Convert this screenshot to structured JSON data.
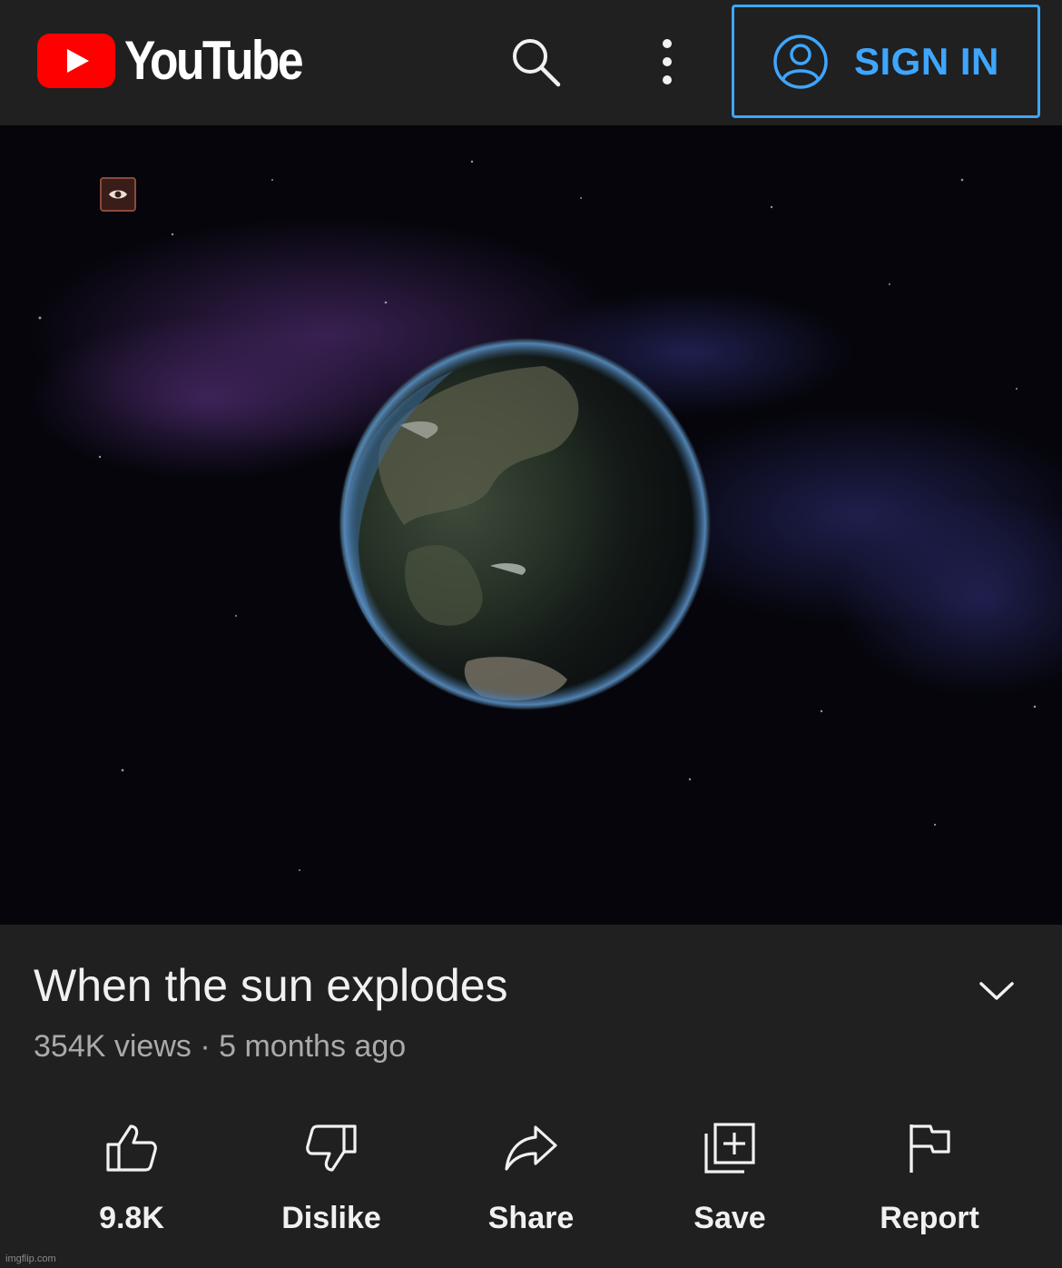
{
  "header": {
    "logo_text": "YouTube",
    "search_icon": "search-icon",
    "more_icon": "more-vert-icon",
    "sign_in_label": "SIGN IN",
    "sign_in_icon": "account-circle-icon",
    "accent_color": "#3ea6ff",
    "brand_color": "#ff0000"
  },
  "video": {
    "title": "When the sun explodes",
    "views": "354K views",
    "separator": "·",
    "age": "5 months ago",
    "expand_icon": "chevron-down-icon"
  },
  "actions": [
    {
      "label": "9.8K",
      "icon": "thumb-up-icon"
    },
    {
      "label": "Dislike",
      "icon": "thumb-down-icon"
    },
    {
      "label": "Share",
      "icon": "share-icon"
    },
    {
      "label": "Save",
      "icon": "playlist-add-icon"
    },
    {
      "label": "Report",
      "icon": "flag-icon"
    }
  ],
  "watermark": "imgflip.com"
}
